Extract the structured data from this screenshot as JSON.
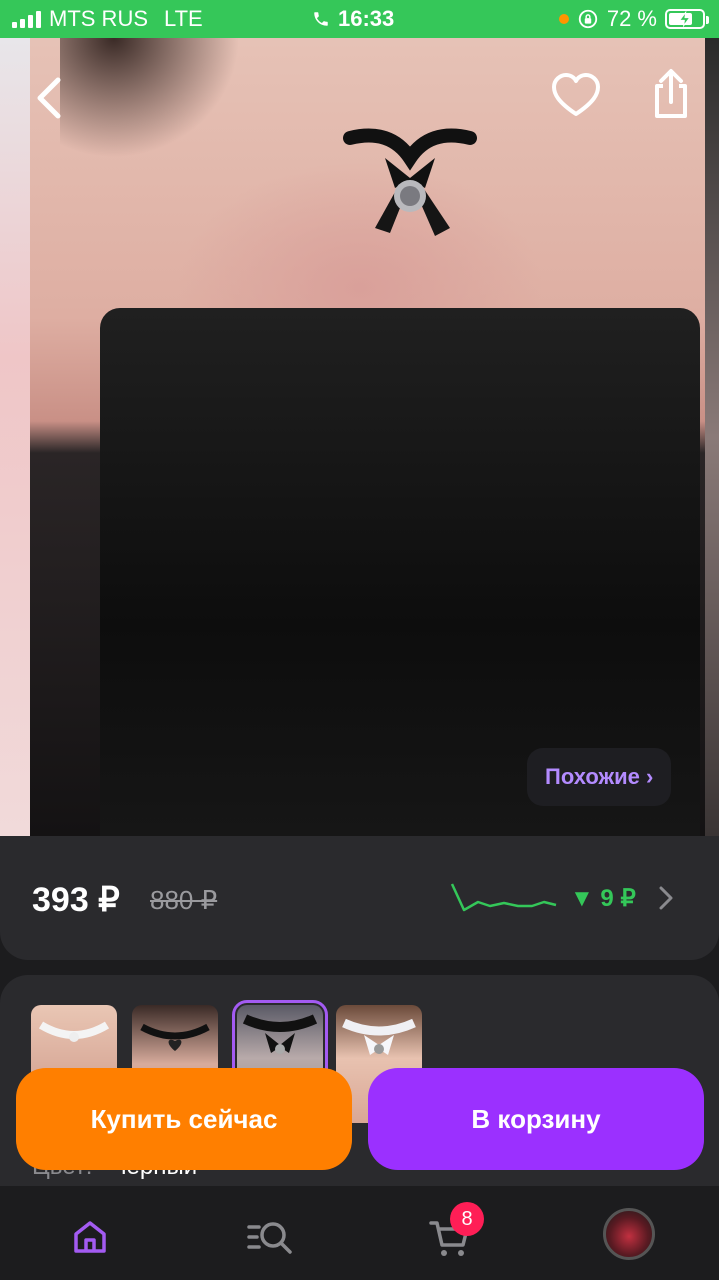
{
  "status_bar": {
    "carrier": "MTS RUS",
    "network": "LTE",
    "time": "16:33",
    "battery_percent": "72 %",
    "battery_level": 0.72
  },
  "product": {
    "similar_label": "Похожие ›",
    "price": "393 ₽",
    "old_price": "880 ₽",
    "price_drop": "▼ 9 ₽",
    "color_label": "Цвет:",
    "color_value": "черный"
  },
  "variants": [
    {
      "name": "white-lace-choker"
    },
    {
      "name": "black-heart-choker"
    },
    {
      "name": "black-bow-choker",
      "selected": true
    },
    {
      "name": "white-bow-choker"
    }
  ],
  "actions": {
    "buy_now": "Купить сейчас",
    "add_to_cart": "В корзину"
  },
  "nav": {
    "cart_badge": "8",
    "items": [
      "home-icon",
      "catalog-search-icon",
      "cart-icon",
      "profile-avatar"
    ]
  },
  "colors": {
    "status_bar": "#35c759",
    "buy_button": "#ff7f00",
    "cart_button": "#9b30ff",
    "accent_text": "#b38bff",
    "price_drop": "#34c759",
    "badge": "#ff1e56"
  }
}
